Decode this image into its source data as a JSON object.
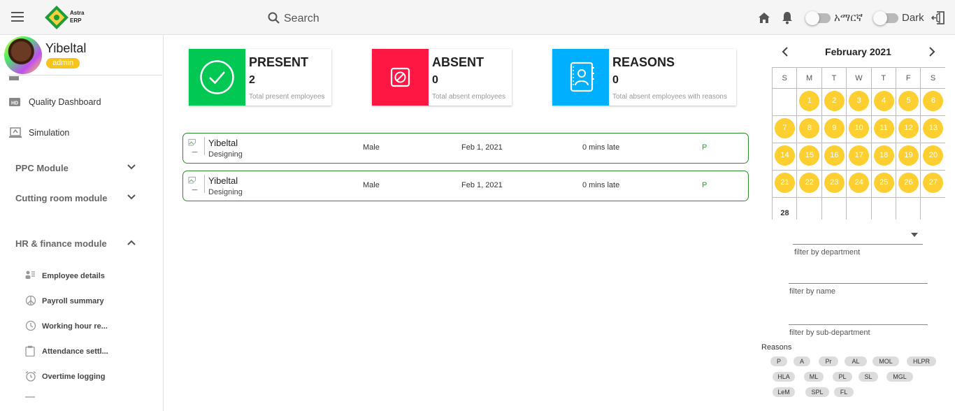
{
  "app": {
    "logo_line1": "Astra",
    "logo_line2": "ERP"
  },
  "header": {
    "search_placeholder": "Search",
    "language_label": "አማርኛ",
    "theme_label": "Dark"
  },
  "user": {
    "name": "Yibeltal",
    "role": "admin"
  },
  "sidebar": {
    "items": [
      {
        "label": "Quality Dashboard",
        "icon": "hd-icon"
      },
      {
        "label": "Simulation",
        "icon": "simulation-icon"
      }
    ],
    "modules": [
      {
        "label": "PPC Module",
        "expanded": false
      },
      {
        "label": "Cutting room module",
        "expanded": false
      },
      {
        "label": "HR & finance module",
        "expanded": true
      }
    ],
    "hr_items": [
      {
        "label": "Employee details",
        "icon": "employee-icon"
      },
      {
        "label": "Payroll summary",
        "icon": "peace-icon"
      },
      {
        "label": "Working hour re...",
        "icon": "clock-icon"
      },
      {
        "label": "Attendance settl...",
        "icon": "clipboard-icon"
      },
      {
        "label": "Overtime logging",
        "icon": "alarm-icon"
      }
    ]
  },
  "cards": [
    {
      "title": "PRESENT",
      "count": "2",
      "desc": "Total present employees",
      "color": "#00c853",
      "icon": "check-circle-icon"
    },
    {
      "title": "ABSENT",
      "count": "0",
      "desc": "Total absent employees",
      "color": "#ff1744",
      "icon": "block-icon"
    },
    {
      "title": "REASONS",
      "count": "0",
      "desc": "Total absent employees with reasons",
      "color": "#00b0ff",
      "icon": "contact-book-icon"
    }
  ],
  "attendance": [
    {
      "name": "Yibeltal",
      "dept": "Designing",
      "gender": "Male",
      "date": "Feb 1, 2021",
      "late": "0 mins late",
      "status": "P"
    },
    {
      "name": "Yibeltal",
      "dept": "Designing",
      "gender": "Male",
      "date": "Feb 1, 2021",
      "late": "0 mins late",
      "status": "P"
    }
  ],
  "calendar": {
    "month": "February 2021",
    "weekdays": [
      "S",
      "M",
      "T",
      "W",
      "T",
      "F",
      "S"
    ],
    "start_weekday": 1,
    "days_in_month": 28,
    "highlighted_days": [
      1,
      2,
      3,
      4,
      5,
      6,
      7,
      8,
      9,
      10,
      11,
      12,
      13,
      14,
      15,
      16,
      17,
      18,
      19,
      20,
      21,
      22,
      23,
      24,
      25,
      26,
      27
    ]
  },
  "filters": {
    "department": "filter by department",
    "name": "filter by name",
    "sub_department": "filter by sub-department"
  },
  "reasons": {
    "title": "Reasons",
    "chips": [
      "P",
      "A",
      "Pr",
      "AL",
      "MOL",
      "HLPR",
      "HLA",
      "ML",
      "PL",
      "SL",
      "MGL",
      "LeM",
      "SPL",
      "FL"
    ]
  },
  "colors": {
    "accent": "#fdcf30",
    "present": "#00c853",
    "absent": "#ff1744",
    "reasons": "#00b0ff",
    "row_border": "#2e8b2e"
  }
}
